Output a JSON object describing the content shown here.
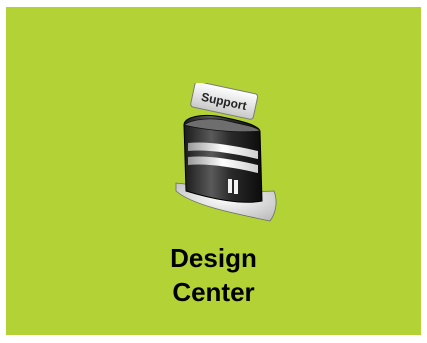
{
  "tile": {
    "background_color": "#b3d236",
    "icon": "support-building-icon",
    "sign_text": "Support",
    "label_line1": "Design",
    "label_line2": "Center"
  }
}
